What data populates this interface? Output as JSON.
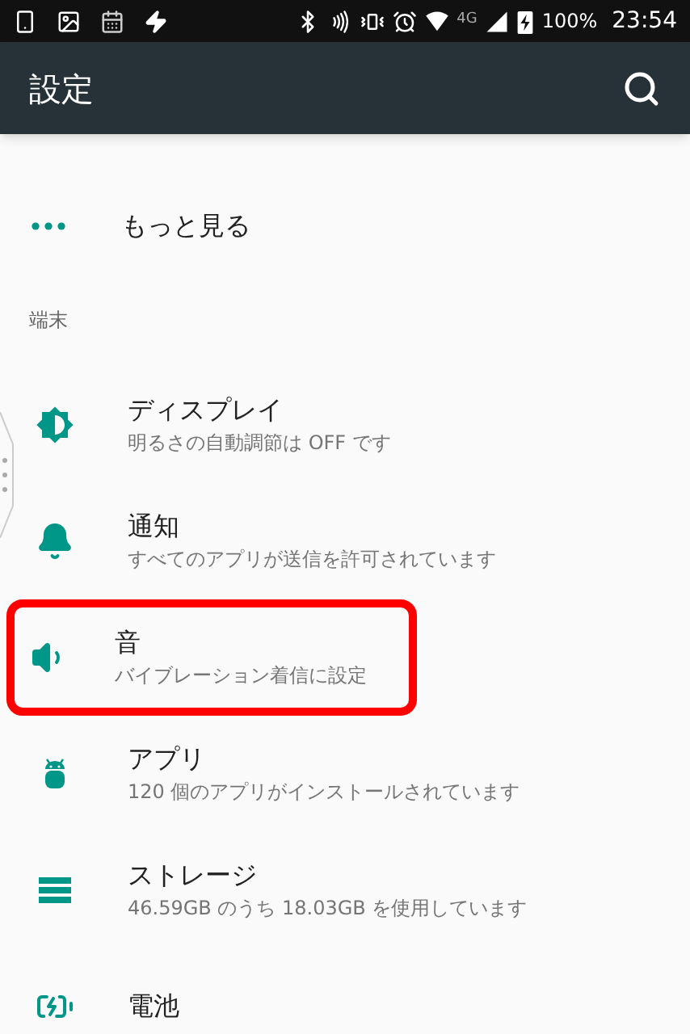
{
  "status_bar": {
    "network": "4G",
    "battery": "100%",
    "time": "23:54"
  },
  "app_bar": {
    "title": "設定"
  },
  "top_items": [
    {
      "title": "もっと見る"
    }
  ],
  "section": {
    "header": "端末"
  },
  "items": [
    {
      "title": "ディスプレイ",
      "subtitle": "明るさの自動調節は OFF です",
      "highlighted": false
    },
    {
      "title": "通知",
      "subtitle": "すべてのアプリが送信を許可されています",
      "highlighted": false
    },
    {
      "title": "音",
      "subtitle": "バイブレーション着信に設定",
      "highlighted": true
    },
    {
      "title": "アプリ",
      "subtitle": "120 個のアプリがインストールされています",
      "highlighted": false
    },
    {
      "title": "ストレージ",
      "subtitle": "46.59GB のうち 18.03GB を使用しています",
      "highlighted": false
    },
    {
      "title": "電池",
      "highlighted": false
    }
  ]
}
